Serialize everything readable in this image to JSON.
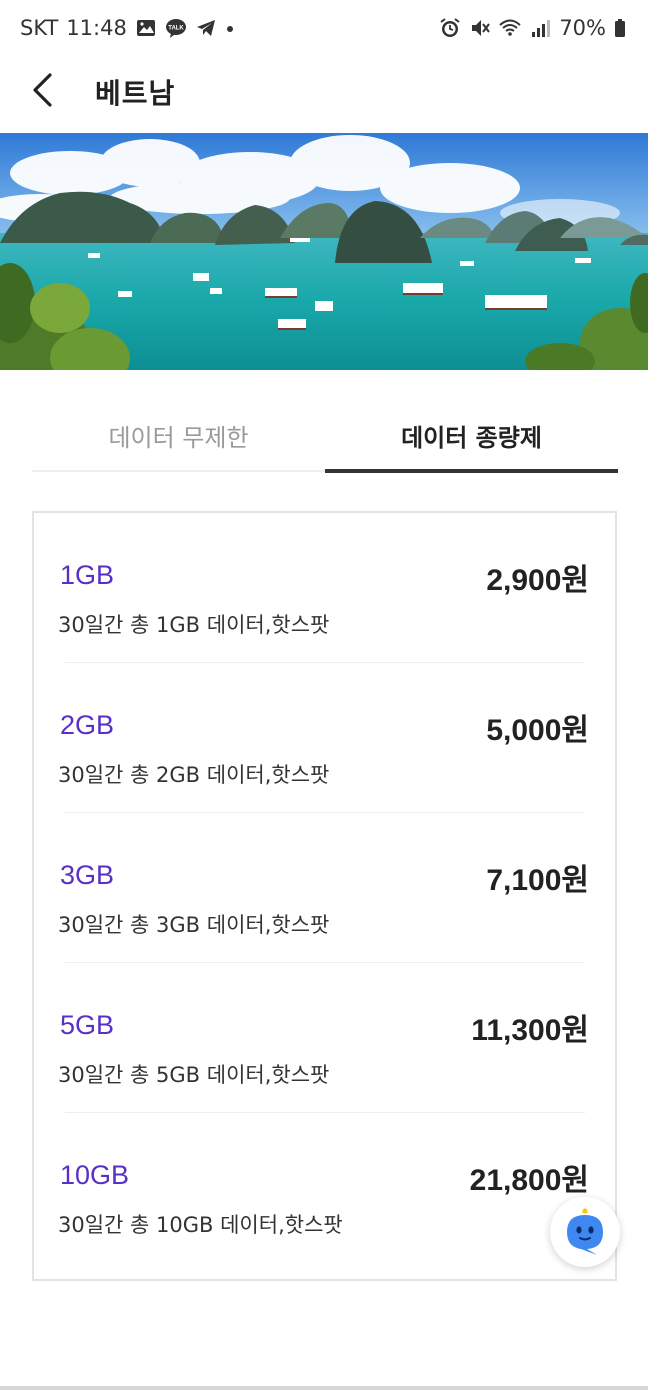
{
  "status_bar": {
    "carrier": "SKT",
    "time": "11:48",
    "battery": "70%",
    "icons": [
      "gallery-icon",
      "kakaotalk-icon",
      "telegram-icon",
      "notification-dot-icon",
      "alarm-icon",
      "mute-icon",
      "wifi-icon",
      "signal-icon",
      "battery-icon"
    ]
  },
  "header": {
    "title": "베트남",
    "back_icon": "chevron-left-icon"
  },
  "hero": {
    "image": "halong-bay-banner"
  },
  "tabs": [
    {
      "label": "데이터 무제한",
      "active": false
    },
    {
      "label": "데이터 종량제",
      "active": true
    }
  ],
  "plans": [
    {
      "name": "1GB",
      "desc": "30일간 총 1GB 데이터,핫스팟",
      "price": "2,900원"
    },
    {
      "name": "2GB",
      "desc": "30일간 총 2GB 데이터,핫스팟",
      "price": "5,000원"
    },
    {
      "name": "3GB",
      "desc": "30일간 총 3GB 데이터,핫스팟",
      "price": "7,100원"
    },
    {
      "name": "5GB",
      "desc": "30일간 총 5GB 데이터,핫스팟",
      "price": "11,300원"
    },
    {
      "name": "10GB",
      "desc": "30일간 총 10GB 데이터,핫스팟",
      "price": "21,800원"
    }
  ],
  "chatbot": {
    "icon": "chatbot-icon"
  },
  "colors": {
    "accent": "#5a2fc8",
    "active_tab": "#333333",
    "inactive_tab": "#9a9a9a",
    "chatbot": "#3f88f2"
  }
}
